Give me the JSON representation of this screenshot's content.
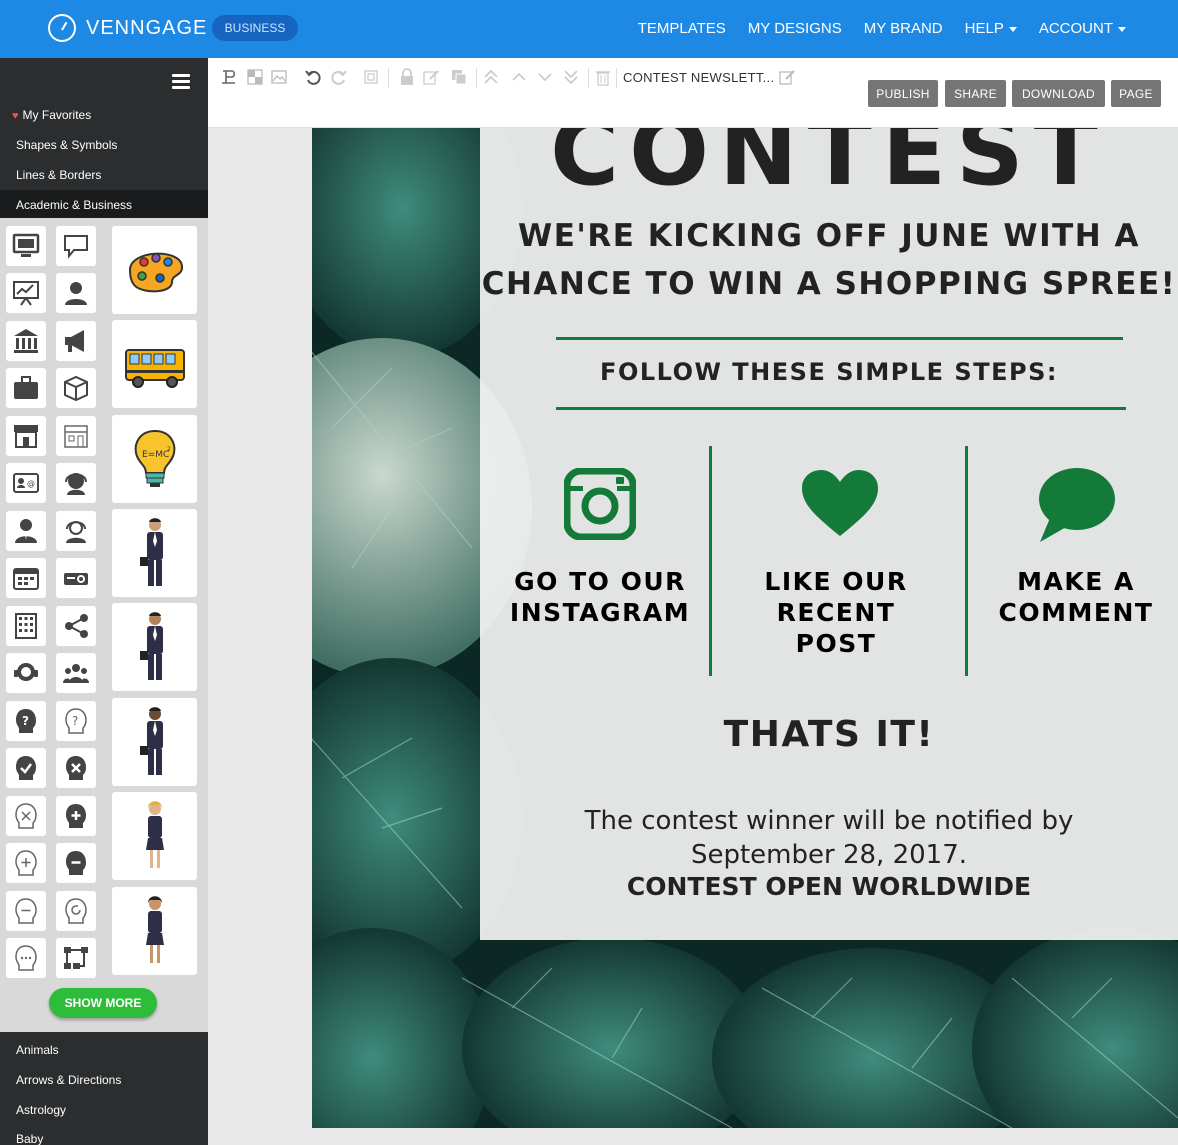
{
  "brand": {
    "name": "VENNGAGE",
    "plan": "BUSINESS"
  },
  "nav": {
    "templates": "TEMPLATES",
    "my_designs": "MY DESIGNS",
    "my_brand": "MY BRAND",
    "help": "HELP",
    "account": "ACCOUNT"
  },
  "sidebar": {
    "categories_top": [
      "My Favorites",
      "Shapes & Symbols",
      "Lines & Borders",
      "Academic & Business"
    ],
    "show_more": "SHOW MORE",
    "categories_bottom": [
      "Animals",
      "Arrows & Directions",
      "Astrology",
      "Baby"
    ]
  },
  "toolbar": {
    "doc_title": "CONTEST NEWSLETT...",
    "publish": "PUBLISH",
    "share": "SHARE",
    "download": "DOWNLOAD",
    "page": "PAGE"
  },
  "design": {
    "title": "CONTEST",
    "headline_line1": "WE'RE KICKING OFF JUNE WITH A",
    "headline_line2": "CHANCE TO WIN A SHOPPING SPREE!",
    "follow": "FOLLOW THESE SIMPLE STEPS:",
    "step1_line1": "GO TO OUR",
    "step1_line2": "INSTAGRAM",
    "step2_line1": "LIKE OUR",
    "step2_line2": "RECENT",
    "step2_line3": "POST",
    "step3_line1": "MAKE A",
    "step3_line2": "COMMENT",
    "thats_it": "THATS IT!",
    "body_line1": "The contest winner will be notified by",
    "body_line2": "September 28, 2017.",
    "open": "CONTEST OPEN WORLDWIDE",
    "accent_color": "#137a3a"
  }
}
